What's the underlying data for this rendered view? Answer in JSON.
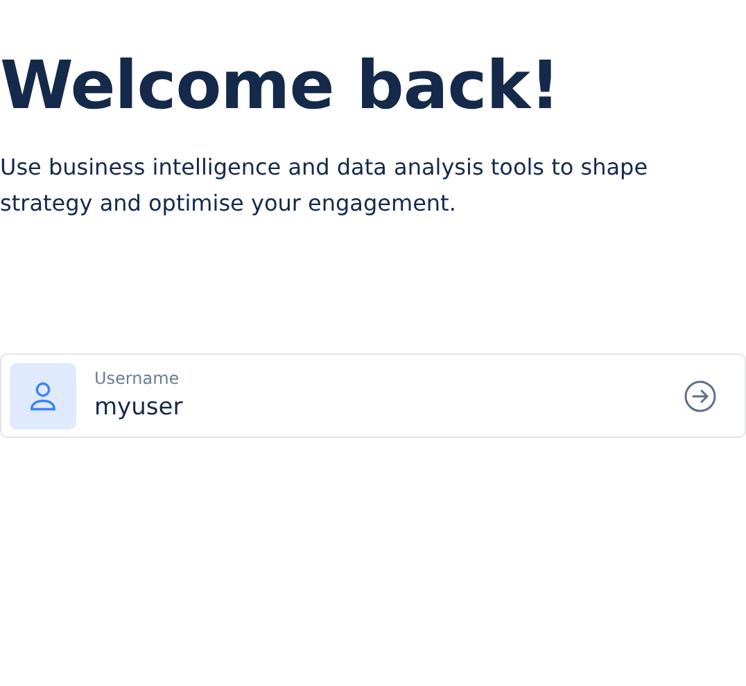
{
  "heading": "Welcome back!",
  "subtitle": "Use business intelligence and data analysis tools to shape strategy and optimise your engagement.",
  "username_field": {
    "label": "Username",
    "value": "myuser"
  }
}
